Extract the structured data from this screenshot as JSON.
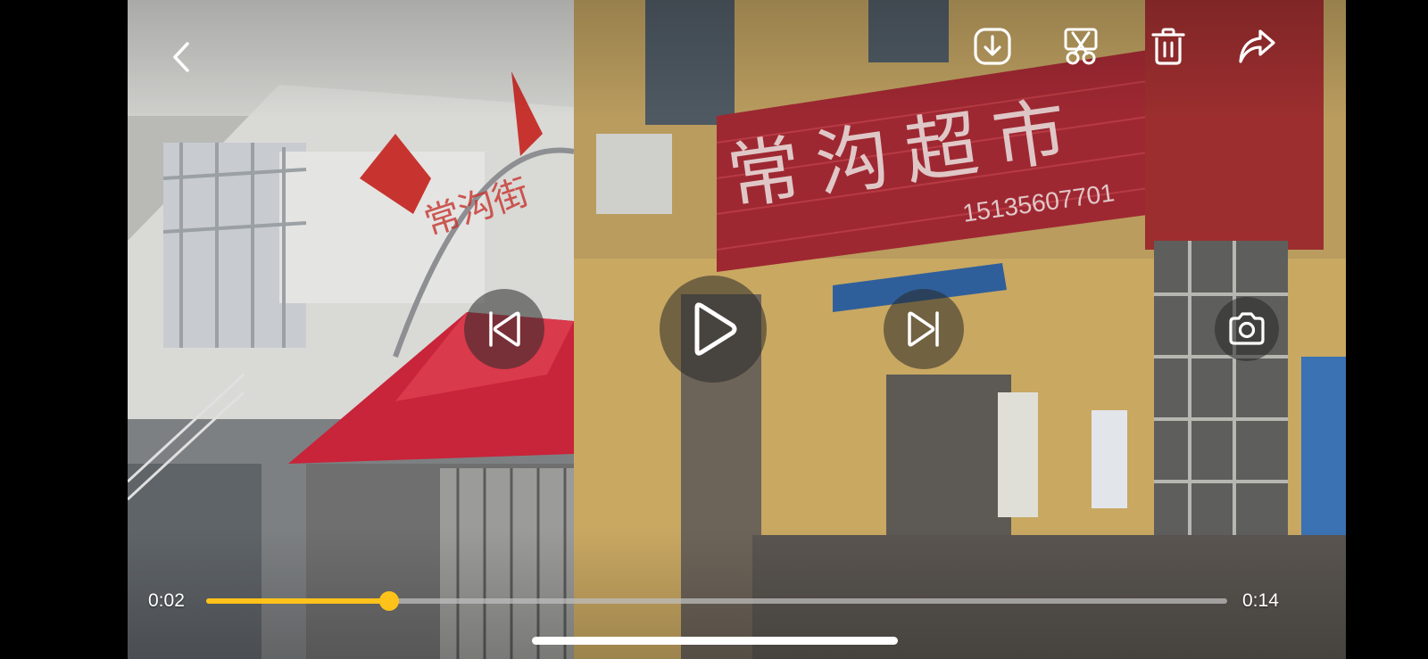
{
  "player": {
    "current_time": "0:02",
    "duration": "0:14",
    "progress_fraction": 0.179,
    "accent_color": "#FFC21A"
  },
  "scene": {
    "shop_sign_text": "常沟超市",
    "shop_phone": "15135607701",
    "arch_text": "常沟街"
  },
  "icons": {
    "back": "chevron-left-icon",
    "download": "download-icon",
    "trim": "scissors-icon",
    "delete": "trash-icon",
    "share": "share-icon",
    "previous": "skip-previous-icon",
    "play": "play-icon",
    "next": "skip-next-icon",
    "screenshot": "camera-icon"
  }
}
